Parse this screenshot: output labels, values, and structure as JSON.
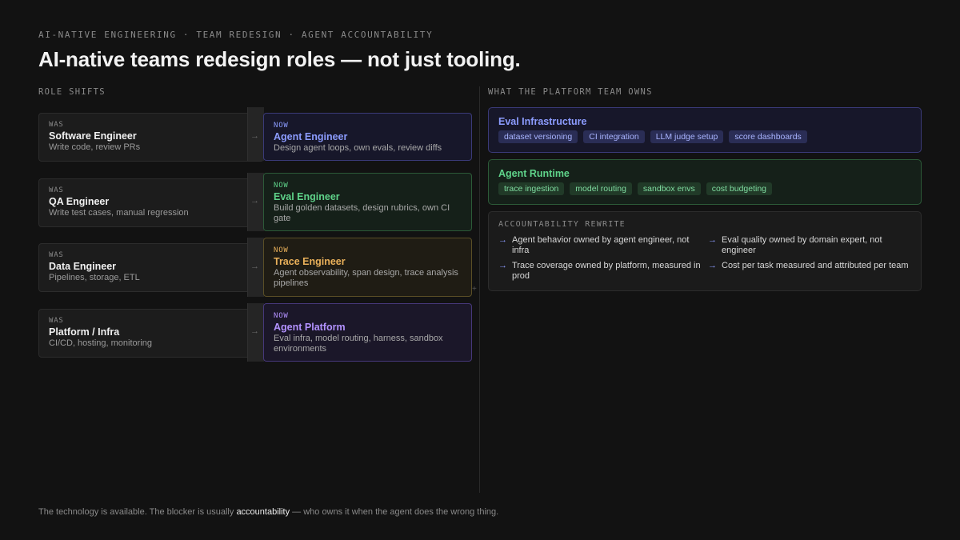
{
  "eyebrow": "AI-NATIVE ENGINEERING · TEAM REDESIGN · AGENT ACCOUNTABILITY",
  "title": "AI-native teams redesign roles — not just tooling.",
  "left_section_label": "ROLE SHIFTS",
  "right_section_label": "WHAT THE PLATFORM TEAM OWNS",
  "was_tag": "WAS",
  "now_tag": "NOW",
  "arrow_glyph": "→",
  "plus_glyph": "+",
  "shifts": [
    {
      "was_role": "Software Engineer",
      "was_desc": "Write code, review PRs",
      "now_role": "Agent Engineer",
      "now_desc": "Design agent loops, own evals, review diffs",
      "accent": "#8c9cff"
    },
    {
      "was_role": "QA Engineer",
      "was_desc": "Write test cases, manual regression",
      "now_role": "Eval Engineer",
      "now_desc": "Build golden datasets, design rubrics, own CI gate",
      "accent": "#5fd38a"
    },
    {
      "was_role": "Data Engineer",
      "was_desc": "Pipelines, storage, ETL",
      "now_role": "Trace Engineer",
      "now_desc": "Agent observability, span design, trace analysis pipelines",
      "accent": "#e9b05a"
    },
    {
      "was_role": "Platform / Infra",
      "was_desc": "CI/CD, hosting, monitoring",
      "now_role": "Agent Platform",
      "now_desc": "Eval infra, model routing, harness, sandbox environments",
      "accent": "#b392ff"
    }
  ],
  "platform": {
    "eval_infra": {
      "title": "Eval Infrastructure",
      "chips": [
        "dataset versioning",
        "CI integration",
        "LLM judge setup",
        "score dashboards"
      ]
    },
    "agent_runtime": {
      "title": "Agent Runtime",
      "chips": [
        "trace ingestion",
        "model routing",
        "sandbox envs",
        "cost budgeting"
      ]
    },
    "accountability": {
      "label": "ACCOUNTABILITY REWRITE",
      "items": [
        "Agent behavior owned by agent engineer, not infra",
        "Eval quality owned by domain expert, not engineer",
        "Trace coverage owned by platform, measured in prod",
        "Cost per task measured and attributed per team"
      ]
    }
  },
  "footer": {
    "pre": "The technology is available. The blocker is usually ",
    "highlight": "accountability",
    "post": " — who owns it when the agent does the wrong thing."
  }
}
